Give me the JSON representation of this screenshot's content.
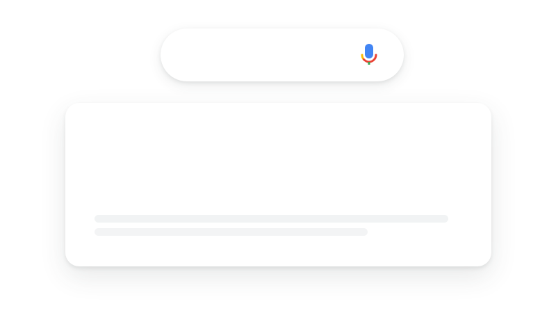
{
  "search": {
    "value": "",
    "placeholder": ""
  },
  "icons": {
    "mic": "microphone-icon"
  },
  "colors": {
    "background": "#ffffff",
    "mic_blue": "#4285F4",
    "mic_red": "#EA4335",
    "mic_yellow": "#FBBC05",
    "mic_green": "#34A853",
    "skeleton": "#f1f3f4"
  },
  "results_card": {
    "state": "loading",
    "skeleton_lines": 2
  }
}
